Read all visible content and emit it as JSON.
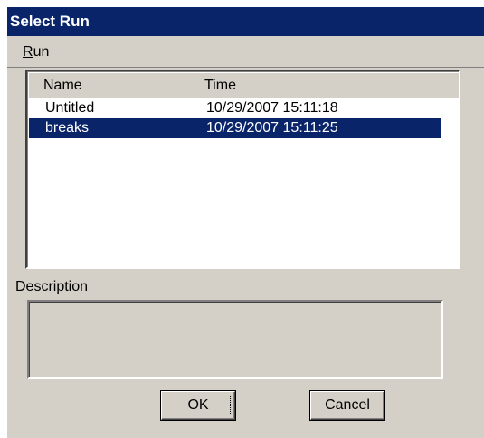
{
  "window": {
    "title": "Select Run"
  },
  "menu": {
    "items": [
      {
        "first": "R",
        "rest": "un"
      }
    ]
  },
  "list": {
    "columns": [
      "Name",
      "Time"
    ],
    "rows": [
      {
        "name": "Untitled",
        "time": "10/29/2007 15:11:18",
        "selected": false
      },
      {
        "name": "breaks",
        "time": "10/29/2007 15:11:25",
        "selected": true
      }
    ]
  },
  "description": {
    "label": "Description",
    "value": ""
  },
  "buttons": {
    "ok": "OK",
    "cancel": "Cancel"
  },
  "colors": {
    "title_bar": "#0a246a",
    "selection": "#0a246a",
    "face": "#d4d0c8"
  }
}
